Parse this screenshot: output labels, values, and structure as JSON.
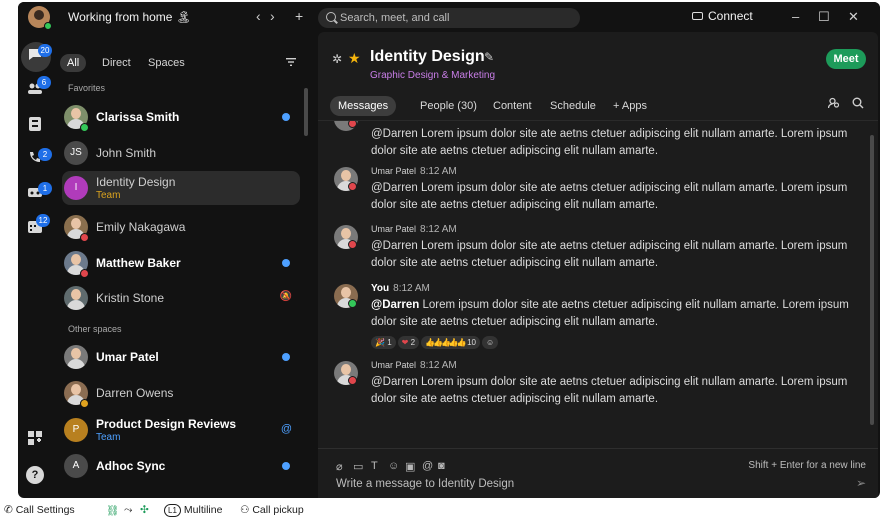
{
  "title_bar": {
    "status_text": "Working from home 🏝",
    "back_label": "‹",
    "forward_label": "›",
    "new_label": "+",
    "search_placeholder": "Search, meet, and call",
    "connect_label": "Connect",
    "minimize_label": "–",
    "maximize_label": "☐",
    "close_label": "✕"
  },
  "rail": {
    "items": [
      {
        "icon": "chat-icon",
        "badge": "20"
      },
      {
        "icon": "teams-icon",
        "badge": "6"
      },
      {
        "icon": "contacts-icon",
        "badge": ""
      },
      {
        "icon": "calls-icon",
        "badge": "2"
      },
      {
        "icon": "voicemail-icon",
        "badge": "1"
      },
      {
        "icon": "calendar-icon",
        "badge": "12"
      }
    ],
    "apps_icon": "apps-icon",
    "help_label": "?"
  },
  "left_panel": {
    "filters": {
      "all": "All",
      "direct": "Direct",
      "spaces": "Spaces"
    },
    "favorites_label": "Favorites",
    "other_spaces_label": "Other spaces",
    "conversations": [
      {
        "name": "Clarissa Smith",
        "sub": "",
        "initials": "",
        "bold": true,
        "indicator": "unread",
        "status": "#34c759"
      },
      {
        "name": "John Smith",
        "sub": "",
        "initials": "JS",
        "bold": false,
        "indicator": "",
        "status": ""
      },
      {
        "name": "Identity Design",
        "sub": "Team",
        "initials": "I",
        "bold": false,
        "indicator": "",
        "status": ""
      },
      {
        "name": "Emily Nakagawa",
        "sub": "",
        "initials": "",
        "bold": false,
        "indicator": "",
        "status": "#e0464c"
      },
      {
        "name": "Matthew Baker",
        "sub": "",
        "initials": "",
        "bold": true,
        "indicator": "unread",
        "status": "#e0464c"
      },
      {
        "name": "Kristin Stone",
        "sub": "",
        "initials": "",
        "bold": false,
        "indicator": "muted",
        "status": ""
      },
      {
        "name": "Umar Patel",
        "sub": "",
        "initials": "",
        "bold": true,
        "indicator": "unread",
        "status": ""
      },
      {
        "name": "Darren Owens",
        "sub": "",
        "initials": "",
        "bold": false,
        "indicator": "",
        "status": "#e0a21f"
      },
      {
        "name": "Product Design Reviews",
        "sub": "Team",
        "initials": "P",
        "bold": true,
        "indicator": "mention",
        "status": ""
      },
      {
        "name": "Adhoc Sync",
        "sub": "",
        "initials": "A",
        "bold": true,
        "indicator": "unread",
        "status": ""
      }
    ],
    "mute_glyph": "🔕",
    "mention_glyph": "@"
  },
  "main": {
    "space_title": "Identity Design",
    "space_subtitle": "Graphic Design & Marketing",
    "meet_label": "Meet",
    "tabs": {
      "messages": "Messages",
      "people": "People (30)",
      "content": "Content",
      "schedule": "Schedule",
      "apps": "+ Apps"
    },
    "messages": [
      {
        "sender": "",
        "time": "",
        "mention": "@Darren",
        "text": " Lorem ipsum dolor site ate aetns ctetuer adipiscing elit nullam amarte. Lorem ipsum dolor site ate aetns ctetuer adipiscing elit nullam amarte."
      },
      {
        "sender": "Umar Patel",
        "time": "8:12 AM",
        "mention": "@Darren",
        "text": " Lorem ipsum dolor site ate aetns ctetuer adipiscing elit nullam amarte. Lorem ipsum dolor site ate aetns ctetuer adipiscing elit nullam amarte."
      },
      {
        "sender": "Umar Patel",
        "time": "8:12 AM",
        "mention": "@Darren",
        "text": " Lorem ipsum dolor site ate aetns ctetuer adipiscing elit nullam amarte. Lorem ipsum dolor site ate aetns ctetuer adipiscing elit nullam amarte."
      },
      {
        "sender": "You",
        "time": "8:12 AM",
        "mention": "@Darren",
        "text": " Lorem ipsum dolor site ate aetns ctetuer adipiscing elit nullam amarte. Lorem ipsum dolor site ate aetns ctetuer adipiscing elit nullam amarte."
      },
      {
        "sender": "Umar Patel",
        "time": "8:12 AM",
        "mention": "@Darren",
        "text": " Lorem ipsum dolor site ate aetns ctetuer adipiscing elit nullam amarte. Lorem ipsum dolor site ate aetns ctetuer adipiscing elit nullam amarte."
      }
    ],
    "reactions": [
      {
        "emoji": "🎉",
        "count": "1"
      },
      {
        "emoji": "❤",
        "count": "2"
      },
      {
        "emoji": "👍👍👍👍👍",
        "count": "10"
      },
      {
        "emoji": "☺",
        "count": ""
      }
    ],
    "composer": {
      "hint": "Shift + Enter for a new line",
      "placeholder": "Write a message to Identity Design",
      "send_glyph": "➢"
    }
  },
  "bottom_bar": {
    "call_settings": "Call Settings",
    "multiline_badge": "L1",
    "multiline": "Multiline",
    "call_pickup": "Call pickup"
  }
}
